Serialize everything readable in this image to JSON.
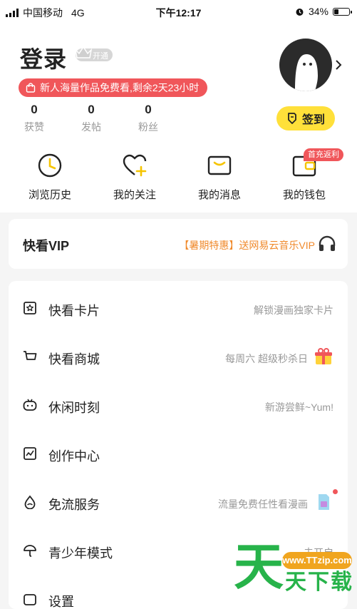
{
  "status_bar": {
    "carrier": "中国移动",
    "network": "4G",
    "time": "下午12:17",
    "battery": "34%",
    "battery_level": 0.34
  },
  "profile": {
    "login_label": "登录",
    "vip_badge_label": "开通",
    "newbie_banner": "新人海量作品免费看,剩余2天23小时",
    "signin_label": "签到",
    "stats": [
      {
        "value": "0",
        "label": "获赞"
      },
      {
        "value": "0",
        "label": "发帖"
      },
      {
        "value": "0",
        "label": "粉丝"
      }
    ]
  },
  "quick_actions": [
    {
      "label": "浏览历史",
      "icon": "clock-icon"
    },
    {
      "label": "我的关注",
      "icon": "heart-plus-icon"
    },
    {
      "label": "我的消息",
      "icon": "message-icon"
    },
    {
      "label": "我的钱包",
      "icon": "wallet-icon"
    }
  ],
  "wallet_badge": "首充返利",
  "vip": {
    "title": "快看VIP",
    "promo": "【暑期特惠】送网易云音乐VIP",
    "icon": "headphones-icon"
  },
  "menu": [
    {
      "label": "快看卡片",
      "sub": "解锁漫画独家卡片",
      "icon": "card-star-icon"
    },
    {
      "label": "快看商城",
      "sub": "每周六 超级秒杀日",
      "icon": "cart-icon"
    },
    {
      "label": "休闲时刻",
      "sub": "新游尝鲜~Yum!",
      "icon": "game-icon"
    },
    {
      "label": "创作中心",
      "sub": "",
      "icon": "chart-icon"
    },
    {
      "label": "免流服务",
      "sub": "流量免费任性看漫画",
      "icon": "droplet-icon"
    },
    {
      "label": "青少年模式",
      "sub": "未开启",
      "icon": "umbrella-icon"
    },
    {
      "label": "设置",
      "sub": "",
      "icon": "settings-icon"
    }
  ],
  "watermark": {
    "url": "www.TTzip.com",
    "big_char": "天",
    "small_text": "天下载"
  },
  "colors": {
    "accent_yellow": "#ffe03a",
    "banner_red": "#f0565a",
    "promo_orange": "#f08a2c"
  }
}
